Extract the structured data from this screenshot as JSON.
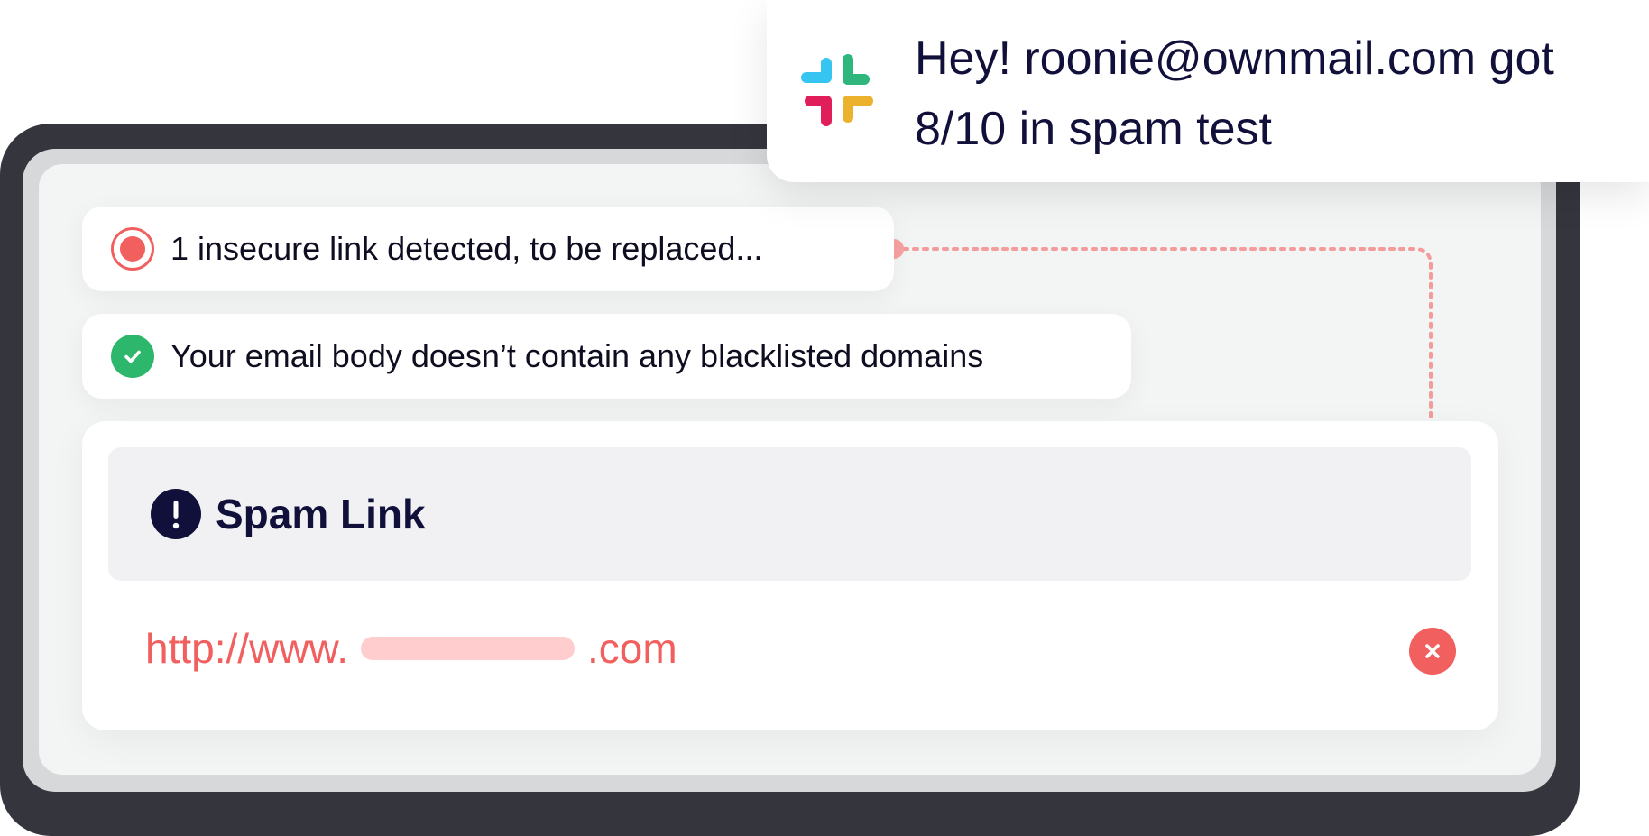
{
  "notification": {
    "app_icon": "slack-logo-icon",
    "line1": "Hey! roonie@ownmail.com got",
    "line2": "8/10 in spam test"
  },
  "checks": [
    {
      "status": "alert",
      "icon": "alert-dot-icon",
      "text": "1 insecure link detected, to be replaced..."
    },
    {
      "status": "ok",
      "icon": "check-circle-icon",
      "text": "Your email body doesn’t contain any blacklisted domains"
    }
  ],
  "spam_link": {
    "icon": "exclamation-icon",
    "title": "Spam Link",
    "url_prefix": "http://www.",
    "url_suffix": ".com",
    "remove_icon": "close-circle-icon"
  },
  "colors": {
    "alert": "#f15f5f",
    "success": "#2db76c",
    "dark": "#10103b",
    "frame": "#35363d",
    "redaction": "#ffcdcd"
  }
}
